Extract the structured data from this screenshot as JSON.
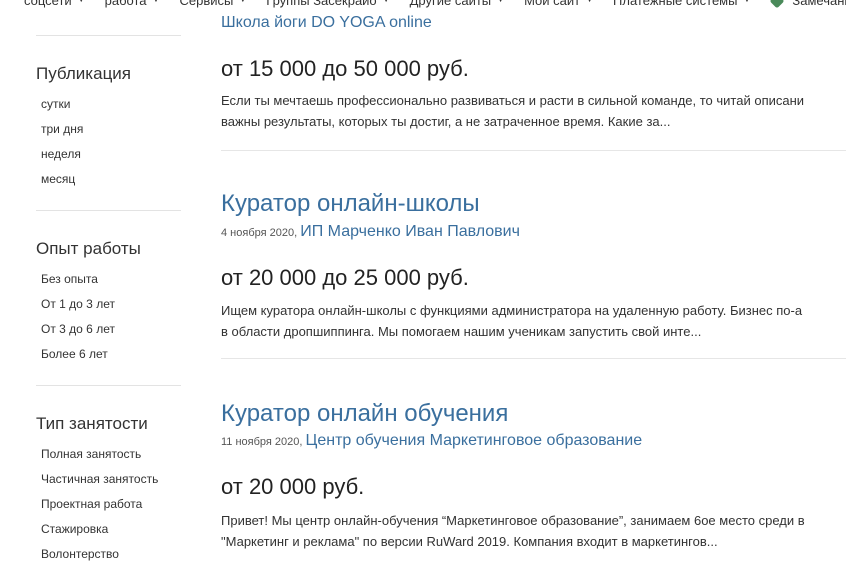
{
  "topnav": {
    "items": [
      {
        "label": "соцсети"
      },
      {
        "label": "работа"
      },
      {
        "label": "Сервисы"
      },
      {
        "label": "Группы Засекрайо"
      },
      {
        "label": "Другие сайты"
      },
      {
        "label": "Мой сайт"
      },
      {
        "label": "Платежные системы"
      }
    ],
    "remarks_label": "Замечания по к"
  },
  "sidebar": {
    "publication": {
      "title": "Публикация",
      "options": [
        "сутки",
        "три дня",
        "неделя",
        "месяц"
      ]
    },
    "experience": {
      "title": "Опыт работы",
      "options": [
        "Без опыта",
        "От 1 до 3 лет",
        "От 3 до 6 лет",
        "Более 6 лет"
      ]
    },
    "employment": {
      "title": "Тип занятости",
      "options": [
        "Полная занятость",
        "Частичная занятость",
        "Проектная работа",
        "Стажировка",
        "Волонтерство"
      ]
    }
  },
  "vacancies": [
    {
      "company": "Школа йоги DO YOGA online",
      "salary": "от 15 000 до 50 000 руб.",
      "desc_line1": "Если ты мечтаешь профессионально развиваться и расти в сильной команде, то читай описани",
      "desc_line2": "важны результаты, которых ты достиг, а не затраченное время. Какие за..."
    },
    {
      "title": "Куратор онлайн-школы",
      "date": "4 ноября 2020,",
      "company": "ИП Марченко Иван Павлович",
      "salary": "от 20 000 до 25 000 руб.",
      "desc_line1": "Ищем куратора онлайн-школы с функциями администратора на удаленную работу. Бизнес по-а",
      "desc_line2": "в области дропшиппинга. Мы помогаем нашим ученикам запустить свой инте..."
    },
    {
      "title": "Куратор онлайн обучения",
      "date": "11 ноября 2020,",
      "company": "Центр обучения Маркетинговое образование",
      "salary": "от 20 000 руб.",
      "desc_line1": "Привет! Мы центр онлайн-обучения “Маркетинговое образование”, занимаем 6ое место среди в",
      "desc_line2": "\"Маркетинг и реклама\" по версии RuWard 2019. Компания входит в маркетингов..."
    }
  ]
}
